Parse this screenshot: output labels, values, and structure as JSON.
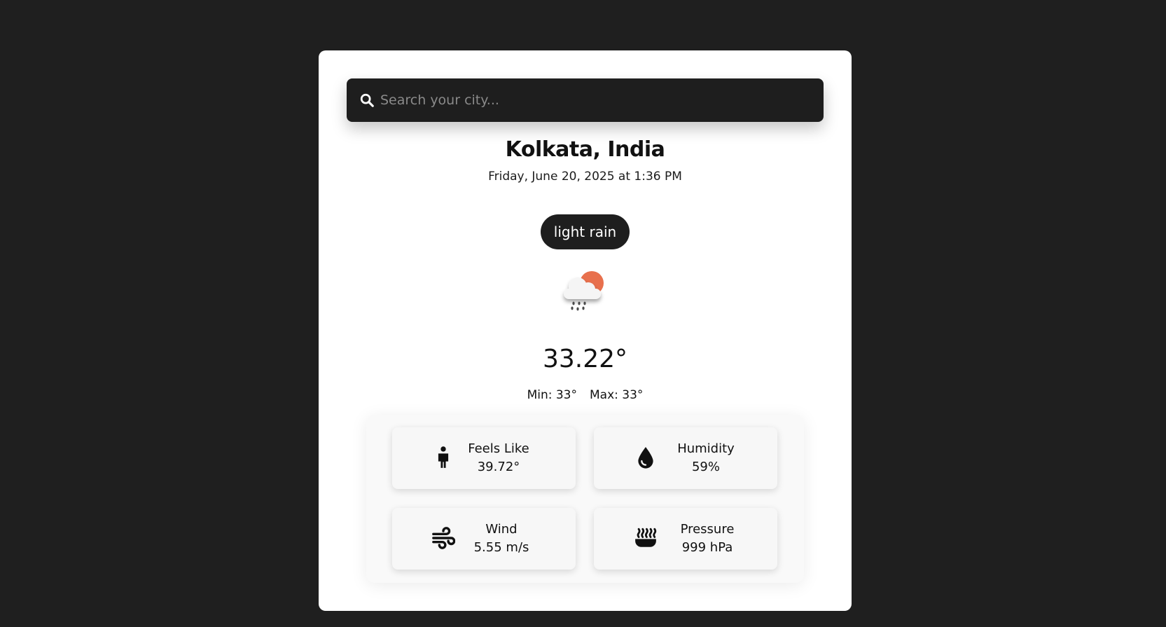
{
  "search": {
    "placeholder": "Search your city...",
    "icon": "search-icon"
  },
  "location": {
    "city": "Kolkata, India",
    "datetime": "Friday, June 20, 2025 at 1:36 PM"
  },
  "weather": {
    "condition": "light rain",
    "icon": "cloud-sun-rain-icon",
    "temperature": "33.22°",
    "min": "Min: 33°",
    "max": "Max: 33°"
  },
  "details": [
    {
      "label": "Feels Like",
      "value": "39.72°",
      "icon": "person-icon"
    },
    {
      "label": "Humidity",
      "value": "59%",
      "icon": "droplet-icon"
    },
    {
      "label": "Wind",
      "value": "5.55 m/s",
      "icon": "wind-icon"
    },
    {
      "label": "Pressure",
      "value": "999 hPa",
      "icon": "pressure-icon"
    }
  ],
  "colors": {
    "background": "#1f1f1f",
    "card": "#ffffff",
    "searchBar": "#1e1e1e",
    "pill": "#1e1e1e",
    "sun": "#e8704d"
  }
}
